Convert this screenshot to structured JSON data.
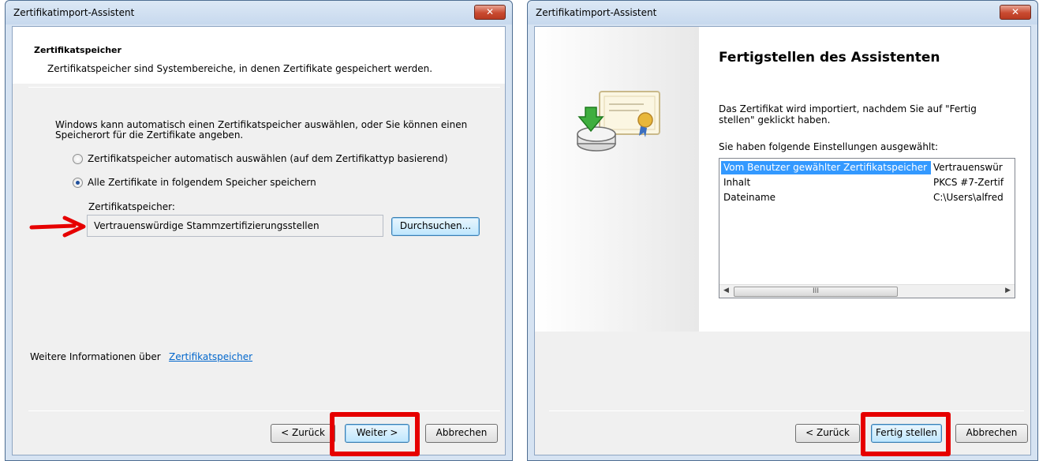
{
  "window1": {
    "title": "Zertifikatimport-Assistent",
    "close_glyph": "✕",
    "header_title": "Zertifikatspeicher",
    "header_desc": "Zertifikatspeicher sind Systembereiche, in denen Zertifikate gespeichert werden.",
    "intro_line1": "Windows kann automatisch einen Zertifikatspeicher auswählen, oder Sie können einen",
    "intro_line2": "Speicherort für die Zertifikate angeben.",
    "radio_auto_label": "Zertifikatspeicher automatisch auswählen (auf dem Zertifikattyp basierend)",
    "radio_manual_label": "Alle Zertifikate in folgendem Speicher speichern",
    "radio_selected": "manual",
    "store_label": "Zertifikatspeicher:",
    "store_value": "Vertrauenswürdige Stammzertifizierungsstellen",
    "browse_button": "Durchsuchen...",
    "more_info_prefix": "Weitere Informationen über",
    "more_info_link": "Zertifikatspeicher",
    "back_button": "< Zurück",
    "next_button": "Weiter >",
    "cancel_button": "Abbrechen"
  },
  "window2": {
    "title": "Zertifikatimport-Assistent",
    "close_glyph": "✕",
    "heading": "Fertigstellen des Assistenten",
    "info_line1": "Das Zertifikat wird importiert, nachdem Sie auf \"Fertig",
    "info_line2": "stellen\" geklickt haben.",
    "settings_label": "Sie haben folgende Einstellungen ausgewählt:",
    "settings_rows": [
      {
        "name": "Vom Benutzer gewählter Zertifikatspeicher",
        "value": "Vertrauenswür"
      },
      {
        "name": "Inhalt",
        "value": "PKCS #7-Zertif"
      },
      {
        "name": "Dateiname",
        "value": "C:\\Users\\alfred"
      }
    ],
    "back_button": "< Zurück",
    "finish_button": "Fertig stellen",
    "cancel_button": "Abbrechen"
  },
  "colors": {
    "annotation_red": "#e60000",
    "link_blue": "#0066cc",
    "selection_blue": "#3399ff"
  },
  "icons": {
    "wizard_image": "certificate-import-icon",
    "annotation_arrow": "red-arrow-icon"
  }
}
